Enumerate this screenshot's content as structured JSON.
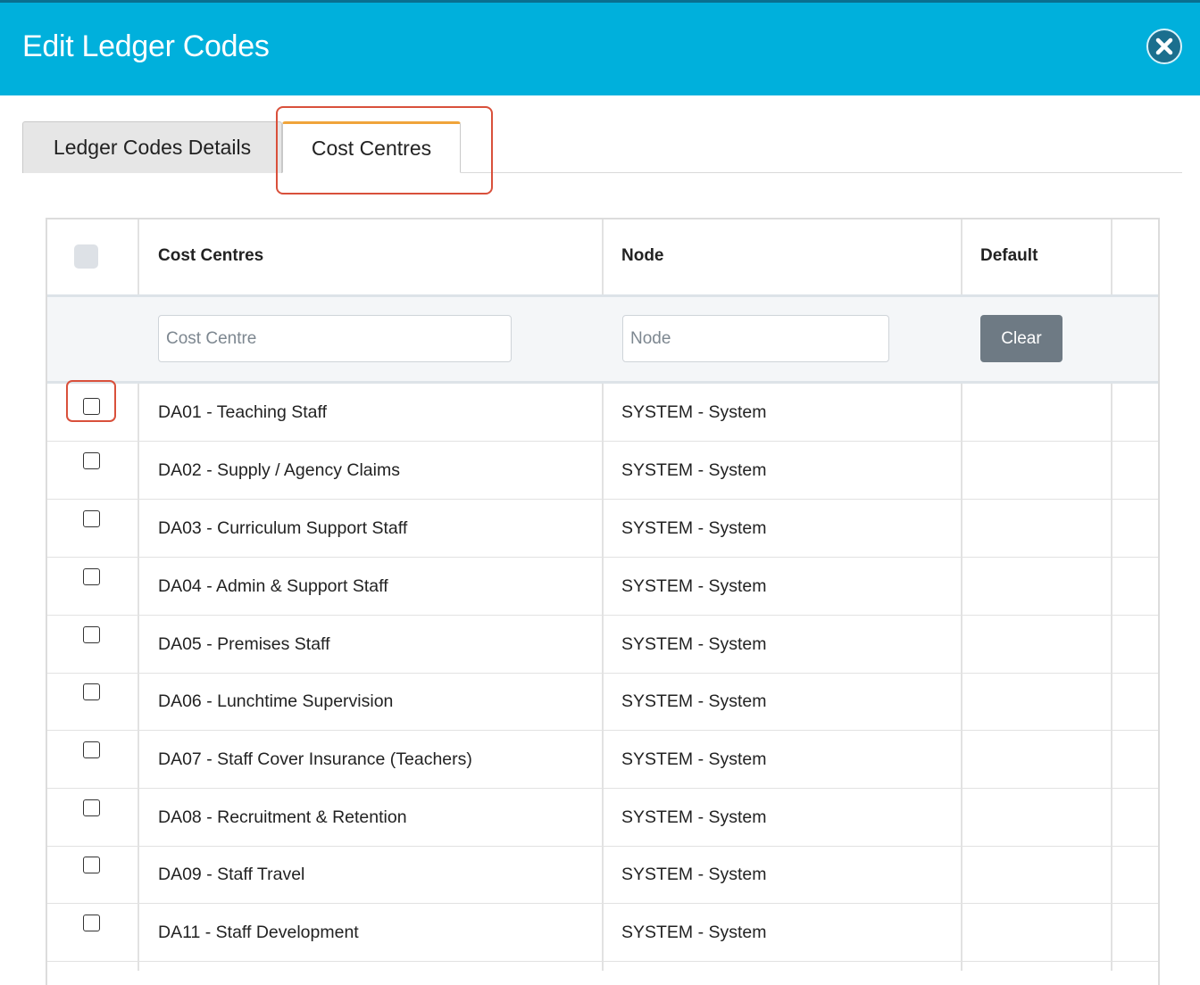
{
  "dialog": {
    "title": "Edit Ledger Codes",
    "close_icon": "close-circle-icon"
  },
  "tabs": [
    {
      "label": "Ledger Codes Details",
      "active": false
    },
    {
      "label": "Cost Centres",
      "active": true
    }
  ],
  "table": {
    "headers": {
      "cost_centres": "Cost Centres",
      "node": "Node",
      "default": "Default"
    },
    "filters": {
      "cost_centre_placeholder": "Cost Centre",
      "node_placeholder": "Node",
      "cost_centre_value": "",
      "node_value": "",
      "clear_label": "Clear"
    },
    "rows": [
      {
        "cost_centre": "DA01 - Teaching Staff",
        "node": "SYSTEM - System",
        "checked": false
      },
      {
        "cost_centre": "DA02 - Supply / Agency Claims",
        "node": "SYSTEM - System",
        "checked": false
      },
      {
        "cost_centre": "DA03 - Curriculum Support Staff",
        "node": "SYSTEM - System",
        "checked": false
      },
      {
        "cost_centre": "DA04 - Admin & Support Staff",
        "node": "SYSTEM - System",
        "checked": false
      },
      {
        "cost_centre": "DA05 - Premises Staff",
        "node": "SYSTEM - System",
        "checked": false
      },
      {
        "cost_centre": "DA06 - Lunchtime Supervision",
        "node": "SYSTEM - System",
        "checked": false
      },
      {
        "cost_centre": "DA07 - Staff Cover Insurance (Teachers)",
        "node": "SYSTEM - System",
        "checked": false
      },
      {
        "cost_centre": "DA08 - Recruitment & Retention",
        "node": "SYSTEM - System",
        "checked": false
      },
      {
        "cost_centre": "DA09 - Staff Travel",
        "node": "SYSTEM - System",
        "checked": false
      },
      {
        "cost_centre": "DA11 - Staff Development",
        "node": "SYSTEM - System",
        "checked": false
      }
    ]
  },
  "colors": {
    "header_bg": "#00b0dc",
    "highlight": "#d9503b",
    "active_tab_accent": "#f0a43a",
    "clear_button": "#6e7a84"
  }
}
